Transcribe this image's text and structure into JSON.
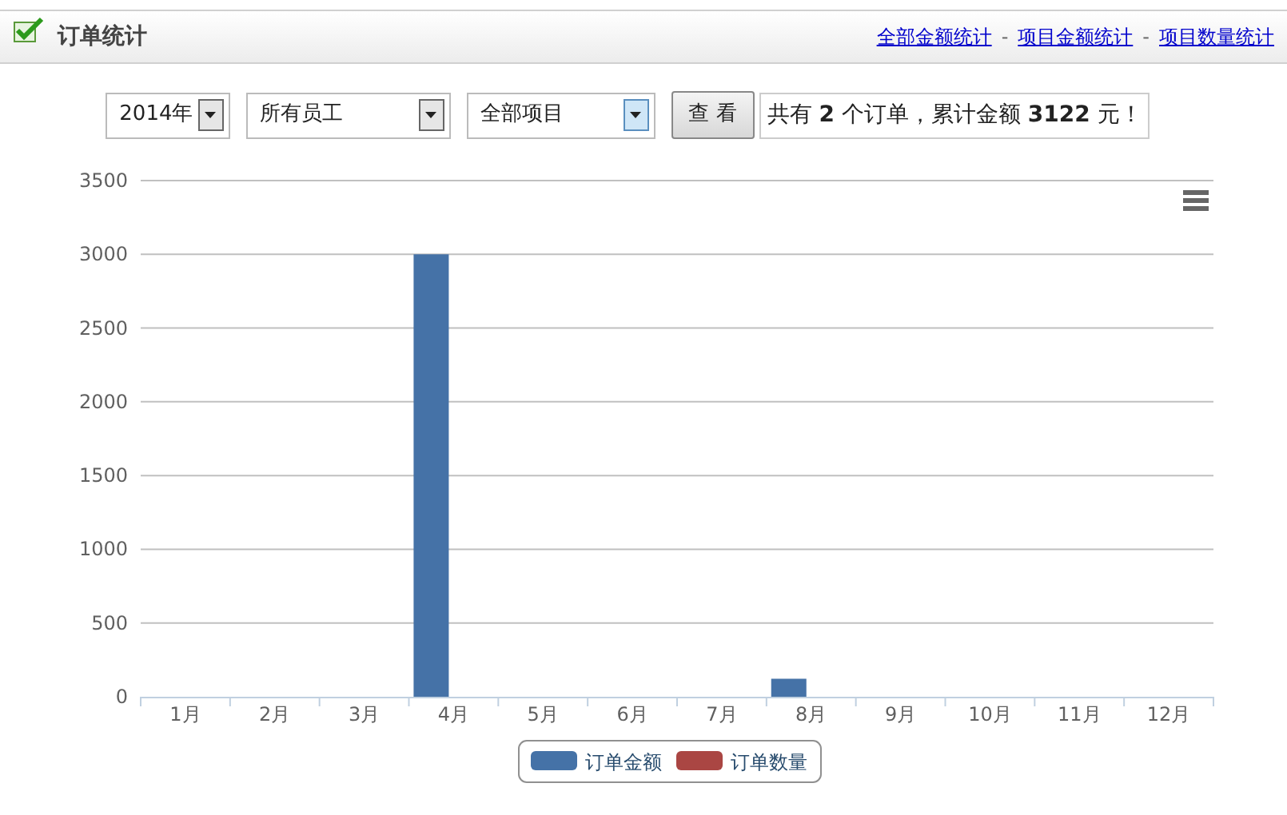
{
  "header": {
    "title": "订单统计",
    "links": [
      "全部金额统计",
      "项目金额统计",
      "项目数量统计"
    ],
    "separator": "-"
  },
  "filters": [
    {
      "value": "2014年",
      "focused": false
    },
    {
      "value": "所有员工",
      "focused": false
    },
    {
      "value": "全部项目",
      "focused": true
    }
  ],
  "view_button": "查 看",
  "summary": "共有 **2** 个订单，累计金额 **3122** 元！",
  "chart": {
    "chart_data": {
      "type": "bar",
      "categories": [
        "1月",
        "2月",
        "3月",
        "4月",
        "5月",
        "6月",
        "7月",
        "8月",
        "9月",
        "10月",
        "11月",
        "12月"
      ],
      "series": [
        {
          "name": "订单金额",
          "color": "#4572a7",
          "values": [
            0,
            0,
            0,
            3000,
            0,
            0,
            0,
            122,
            0,
            0,
            0,
            0
          ]
        },
        {
          "name": "订单数量",
          "color": "#aa4643",
          "values": [
            null,
            null,
            null,
            null,
            null,
            null,
            null,
            null,
            null,
            null,
            null,
            null
          ]
        }
      ],
      "grid": true,
      "legend": true,
      "ylim": [
        0,
        3500
      ],
      "yticks": [
        0,
        500,
        1000,
        1500,
        2000,
        2500,
        3000,
        3500
      ]
    }
  }
}
